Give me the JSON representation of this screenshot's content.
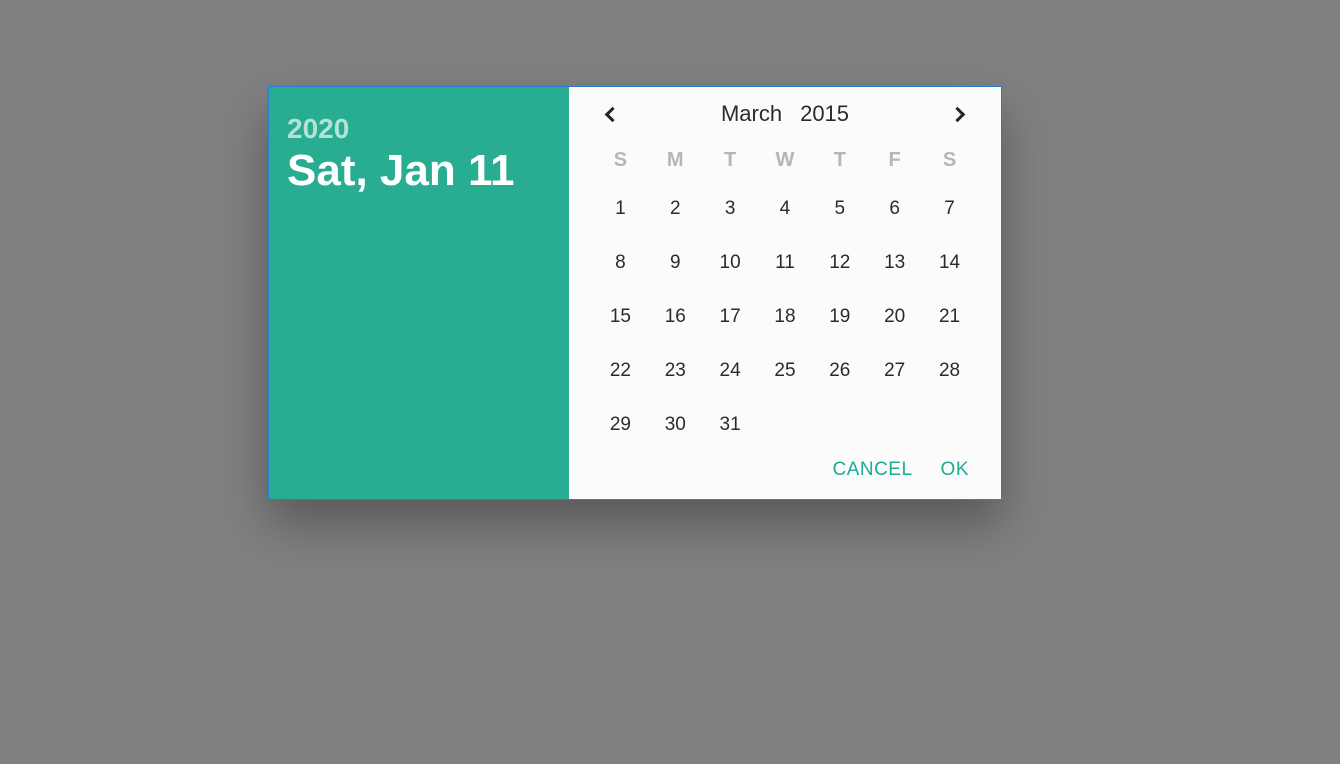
{
  "colors": {
    "accent": "#28ad92",
    "action_text": "#1cab93",
    "border": "#2c7bd0"
  },
  "side": {
    "year": "2020",
    "date": "Sat, Jan 11"
  },
  "calendar": {
    "month_label": "March",
    "year_label": "2015",
    "weekdays": [
      "S",
      "M",
      "T",
      "W",
      "T",
      "F",
      "S"
    ],
    "weeks": [
      [
        "1",
        "2",
        "3",
        "4",
        "5",
        "6",
        "7"
      ],
      [
        "8",
        "9",
        "10",
        "11",
        "12",
        "13",
        "14"
      ],
      [
        "15",
        "16",
        "17",
        "18",
        "19",
        "20",
        "21"
      ],
      [
        "22",
        "23",
        "24",
        "25",
        "26",
        "27",
        "28"
      ],
      [
        "29",
        "30",
        "31",
        "",
        "",
        "",
        ""
      ]
    ]
  },
  "actions": {
    "cancel": "CANCEL",
    "ok": "OK"
  },
  "icons": {
    "prev": "chevron-left-icon",
    "next": "chevron-right-icon"
  }
}
